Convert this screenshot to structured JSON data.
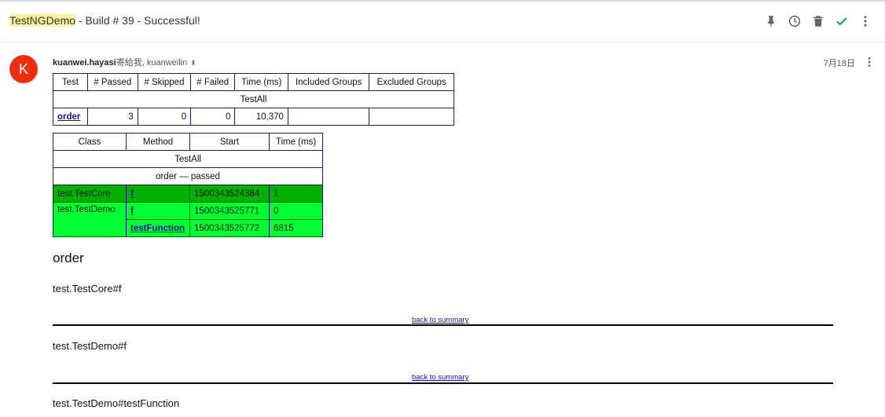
{
  "email": {
    "subject_highlight": "TestNGDemo",
    "subject_rest": " - Build # 39 - Successful!",
    "avatar_letter": "K",
    "sender_name": "kuanwei.hayasi",
    "sender_rest": "寄給我, kuanweilin",
    "date": "7月18日",
    "colors": {
      "avatar": "#ee2e0e",
      "check": "#18a058",
      "highlight": "#fbf39a"
    }
  },
  "icons": [
    "pin-icon",
    "snooze-clock-icon",
    "trash-icon",
    "check-icon",
    "more-vert-icon"
  ],
  "summary_table": {
    "headers": [
      "Test",
      "# Passed",
      "# Skipped",
      "# Failed",
      "Time (ms)",
      "Included Groups",
      "Excluded Groups"
    ],
    "suite": "TestAll",
    "row": {
      "test": "order",
      "passed": "3",
      "skipped": "0",
      "failed": "0",
      "time": "10,370",
      "included": "",
      "excluded": ""
    }
  },
  "methods_table": {
    "headers": [
      "Class",
      "Method",
      "Start",
      "Time (ms)"
    ],
    "suite": "TestAll",
    "group": "order — passed",
    "rows": [
      {
        "class": "test.TestCore",
        "method": "f",
        "start": "1500343524384",
        "time": "1"
      },
      {
        "class": "test.TestDemo",
        "method": "f",
        "start": "1500343525771",
        "time": "0"
      },
      {
        "class": "",
        "method": "testFunction",
        "start": "1500343525772",
        "time": "6815"
      }
    ],
    "colors": {
      "core_row": "#00b000",
      "demo_rows": "#00ff33"
    }
  },
  "details": {
    "heading": "order",
    "sections": [
      {
        "title": "test.TestCore#f",
        "back": "back to summary"
      },
      {
        "title": "test.TestDemo#f",
        "back": "back to summary"
      },
      {
        "title": "test.TestDemo#testFunction"
      }
    ]
  }
}
